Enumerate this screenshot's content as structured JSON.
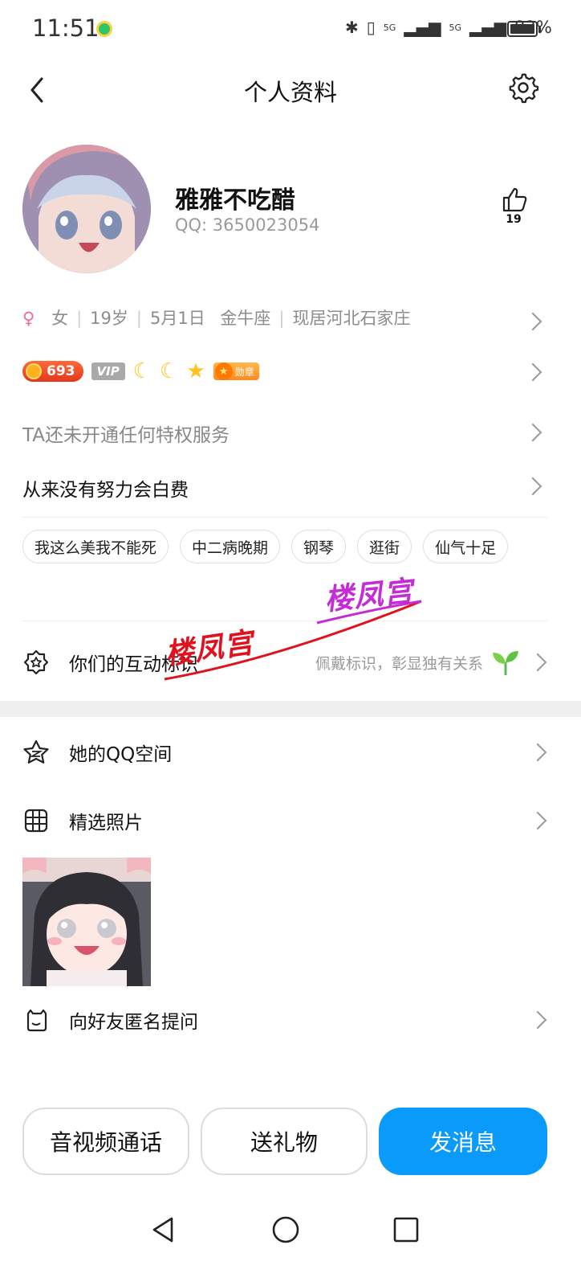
{
  "status": {
    "time": "11:51",
    "net1": "5G",
    "net2": "5G",
    "battery": "92%"
  },
  "header": {
    "title": "个人资料"
  },
  "profile": {
    "name": "雅雅不吃醋",
    "qq": "QQ:  3650023054",
    "likes": "19",
    "gender_symbol": "♀",
    "gender": "女",
    "age": "19岁",
    "birthday": "5月1日",
    "zodiac": "金牛座",
    "location": "现居河北石家庄"
  },
  "badges": {
    "level": "693",
    "vip": "VIP",
    "medal": "勋章",
    "icons": [
      "moon-icon",
      "moon-icon",
      "star-icon"
    ]
  },
  "privilege_text": "TA还未开通任何特权服务",
  "signature": "从来没有努力会白费",
  "tags": [
    "我这么美我不能死",
    "中二病晚期",
    "钢琴",
    "逛街",
    "仙气十足"
  ],
  "interaction": {
    "label": "你们的互动标识",
    "hint": "佩戴标识，彰显独有关系"
  },
  "watermark": {
    "text1": "楼凤宫",
    "text2": "楼凤宫"
  },
  "menu": {
    "qzone": "她的QQ空间",
    "photos": "精选照片",
    "ask": "向好友匿名提问"
  },
  "actions": {
    "call": "音视频通话",
    "gift": "送礼物",
    "message": "发消息"
  },
  "colors": {
    "primary": "#0a9afa",
    "watermark_red": "#e0121f",
    "watermark_purple": "#c52bd6"
  }
}
